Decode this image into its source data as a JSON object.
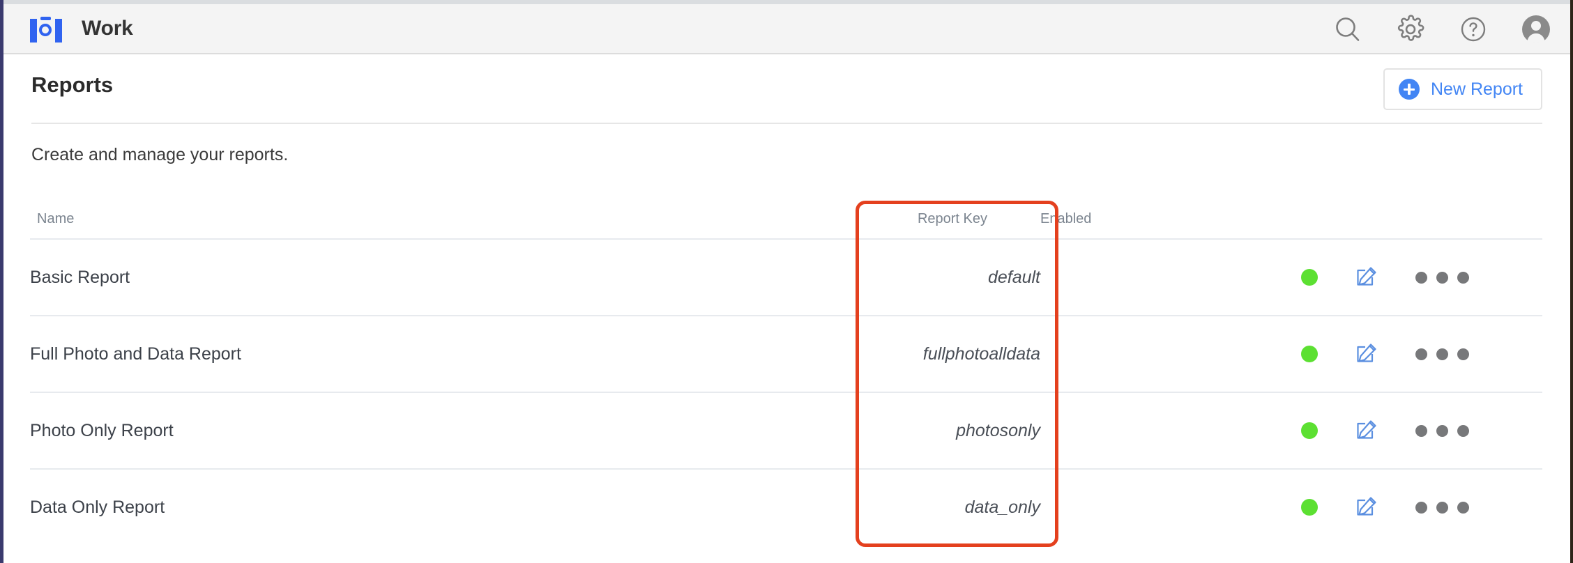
{
  "app": {
    "title": "Work",
    "logo_icon": "camera-logo-icon",
    "actions": [
      {
        "name": "search-icon",
        "label": "Search"
      },
      {
        "name": "settings-gear-icon",
        "label": "Settings"
      },
      {
        "name": "help-circle-icon",
        "label": "Help"
      },
      {
        "name": "user-avatar-icon",
        "label": "Account"
      }
    ]
  },
  "page": {
    "title": "Reports",
    "subtitle": "Create and manage your reports.",
    "new_button": {
      "label": "New Report",
      "icon": "plus-circle-icon"
    }
  },
  "table": {
    "columns": {
      "name": "Name",
      "report_key": "Report Key",
      "enabled": "Enabled"
    },
    "rows": [
      {
        "name": "Basic Report",
        "report_key": "default",
        "enabled": true,
        "status_icon": "green-status-dot",
        "edit_icon": "edit-pencil-icon",
        "more_icon": "more-horizontal-icon"
      },
      {
        "name": "Full Photo and Data Report",
        "report_key": "fullphotoalldata",
        "enabled": true,
        "status_icon": "green-status-dot",
        "edit_icon": "edit-pencil-icon",
        "more_icon": "more-horizontal-icon"
      },
      {
        "name": "Photo Only Report",
        "report_key": "photosonly",
        "enabled": true,
        "status_icon": "green-status-dot",
        "edit_icon": "edit-pencil-icon",
        "more_icon": "more-horizontal-icon"
      },
      {
        "name": "Data Only Report",
        "report_key": "data_only",
        "enabled": true,
        "status_icon": "green-status-dot",
        "edit_icon": "edit-pencil-icon",
        "more_icon": "more-horizontal-icon"
      }
    ]
  },
  "annotation": {
    "target": "report-key-column",
    "color": "#e4401e"
  },
  "colors": {
    "accent_blue": "#4285f4",
    "logo_blue": "#3063f0",
    "status_green": "#5ce032",
    "annotation_red": "#e4401e",
    "appbar_bg": "#f4f4f4",
    "text_dark": "#2b2b2b",
    "text_muted": "#7b848f"
  }
}
